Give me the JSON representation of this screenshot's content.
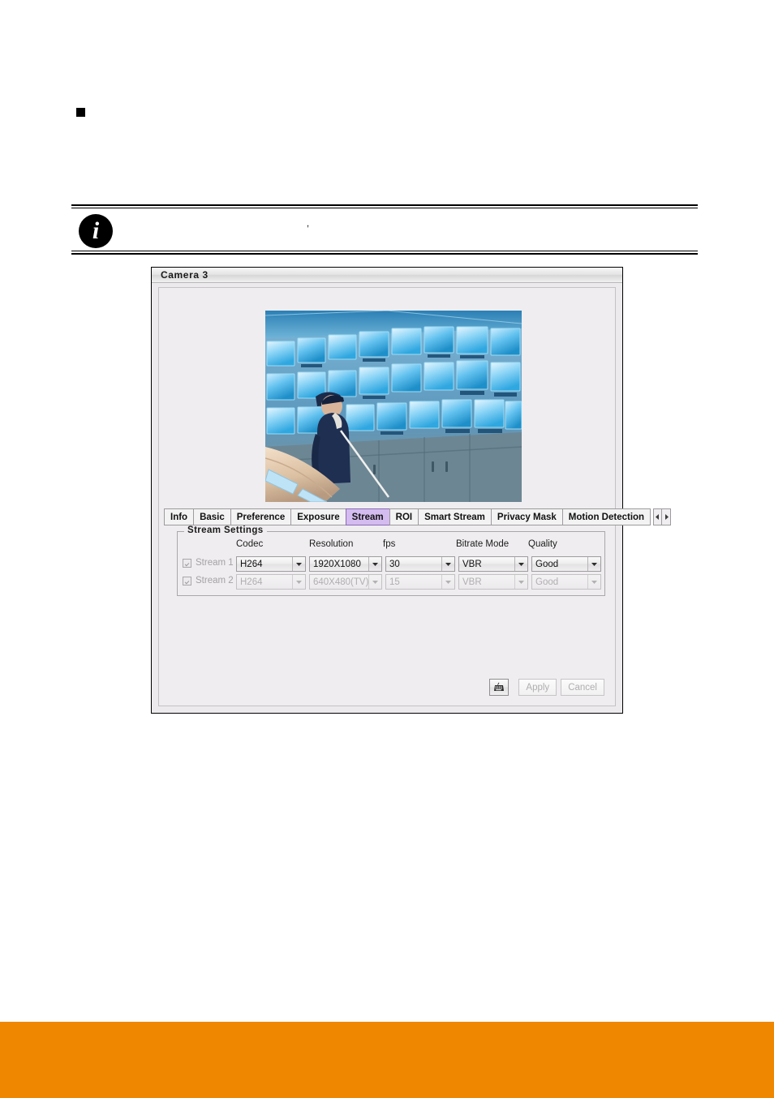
{
  "page": {
    "bullet_marker": "square-bullet",
    "note": {
      "icon": "info-icon",
      "icon_glyph": "i",
      "text": ","
    },
    "footer_color": "#ef8700"
  },
  "window": {
    "title": "Camera 3",
    "preview": {
      "alt": "Live camera preview of a surveillance control room with a wall of blue CCTV monitors and a person wearing a cap speaking on a telephone"
    },
    "tabs": [
      {
        "label": "Info",
        "selected": false
      },
      {
        "label": "Basic",
        "selected": false
      },
      {
        "label": "Preference",
        "selected": false
      },
      {
        "label": "Exposure",
        "selected": false
      },
      {
        "label": "Stream",
        "selected": true
      },
      {
        "label": "ROI",
        "selected": false
      },
      {
        "label": "Smart Stream",
        "selected": false
      },
      {
        "label": "Privacy Mask",
        "selected": false
      },
      {
        "label": "Motion Detection",
        "selected": false
      }
    ],
    "tab_scroll": {
      "prev_icon": "chevron-left-icon",
      "next_icon": "chevron-right-icon"
    },
    "selected_tab_color": "#d4bcf0",
    "stream_settings": {
      "title": "Stream Settings",
      "columns": [
        "Codec",
        "Resolution",
        "fps",
        "Bitrate Mode",
        "Quality"
      ],
      "rows": [
        {
          "label": "Stream 1",
          "enabled": true,
          "checked": true,
          "codec": "H264",
          "resolution": "1920X1080",
          "fps": "30",
          "bitrate_mode": "VBR",
          "quality": "Good"
        },
        {
          "label": "Stream 2",
          "enabled": false,
          "checked": true,
          "codec": "H264",
          "resolution": "640X480(TV)",
          "fps": "15",
          "bitrate_mode": "VBR",
          "quality": "Good"
        }
      ]
    },
    "buttons": {
      "keypad_icon": "keypad-icon",
      "apply_label": "Apply",
      "cancel_label": "Cancel",
      "apply_enabled": false,
      "cancel_enabled": false
    }
  }
}
